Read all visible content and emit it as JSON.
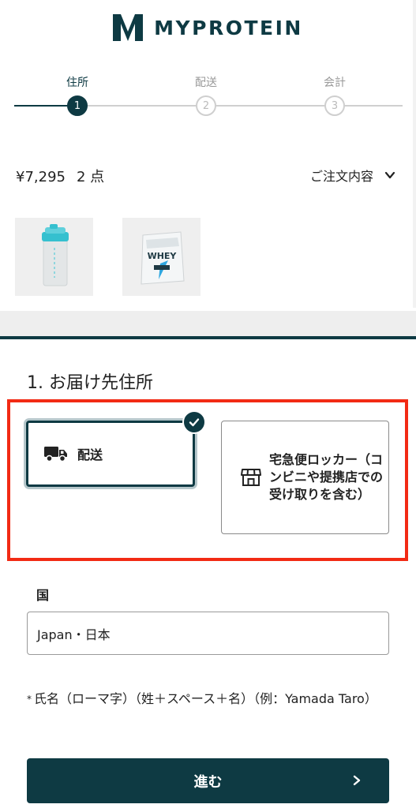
{
  "brand": {
    "name": "MYPROTEIN"
  },
  "stepper": {
    "steps": [
      {
        "label": "住所",
        "number": "1",
        "state": "active"
      },
      {
        "label": "配送",
        "number": "2",
        "state": "inactive"
      },
      {
        "label": "会計",
        "number": "3",
        "state": "inactive"
      }
    ]
  },
  "summary": {
    "total": "¥7,295",
    "count": "2 点",
    "toggle_label": "ご注文内容",
    "toggle_icon": "chevron-down-icon"
  },
  "products": [
    {
      "name": "shaker bottle",
      "icon": "shaker-bottle-image"
    },
    {
      "name": "whey protein pouch",
      "icon": "whey-pouch-image"
    }
  ],
  "address_section": {
    "title": "1. お届け先住所",
    "options": [
      {
        "label": "配送",
        "icon": "truck-icon",
        "selected": true
      },
      {
        "label": "宅急便ロッカー（コンビニや提携店での受け取りを含む）",
        "icon": "store-icon",
        "selected": false
      }
    ]
  },
  "country": {
    "label": "国",
    "value": "Japan・日本"
  },
  "name_field": {
    "required_mark": "*",
    "label": "氏名（ローマ字）（姓＋スペース＋名）（例：Yamada Taro）"
  },
  "next_button": {
    "label": "進む",
    "icon": "chevron-right-icon"
  },
  "colors": {
    "brand": "#0e3a43",
    "highlight": "#f22a14"
  }
}
